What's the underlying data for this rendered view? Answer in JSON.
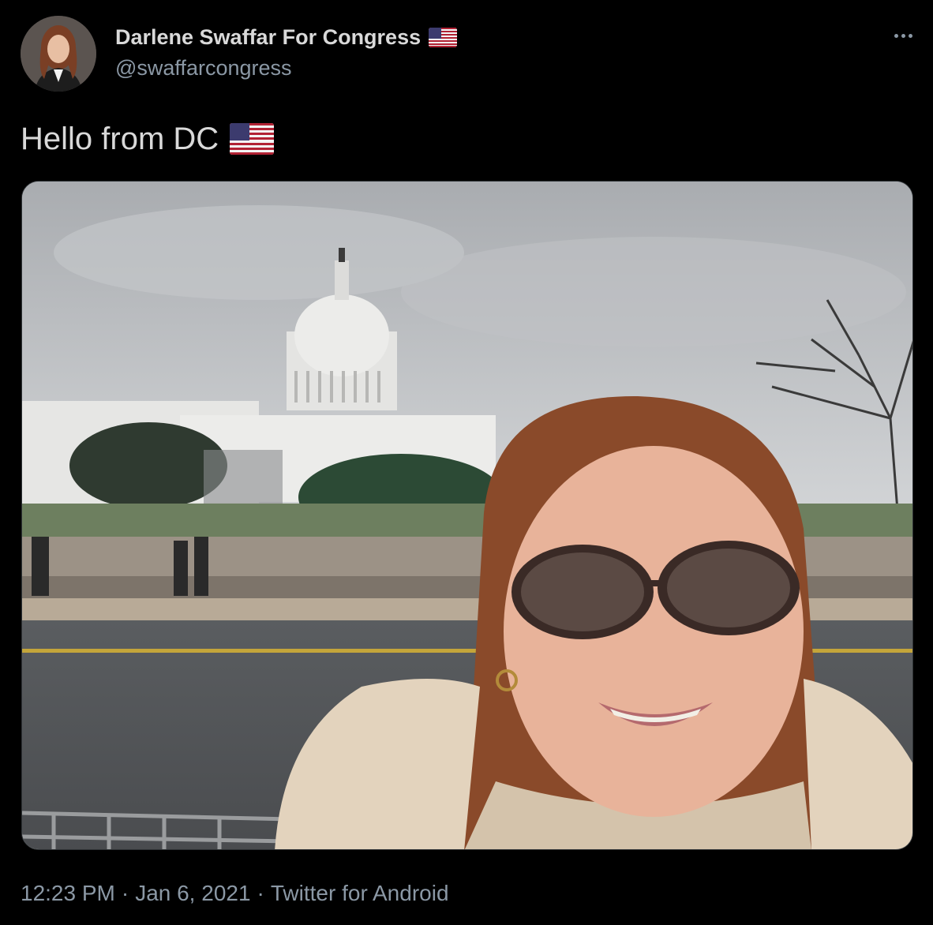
{
  "author": {
    "display_name": "Darlene Swaffar For Congress",
    "name_flag_icon": "us-flag-emoji",
    "handle": "@swaffarcongress",
    "avatar_icon": "profile-photo"
  },
  "more_icon": "ellipsis-icon",
  "tweet": {
    "text": "Hello from DC",
    "text_flag_icon": "us-flag-emoji"
  },
  "media": {
    "description_icon": "selfie-photo"
  },
  "meta": {
    "time": "12:23 PM",
    "separator": "·",
    "date": "Jan 6, 2021",
    "source": "Twitter for Android"
  },
  "colors": {
    "background": "#000000",
    "primary_text": "#d9d9d9",
    "secondary_text": "#8b98a5",
    "border": "#2f3336"
  }
}
